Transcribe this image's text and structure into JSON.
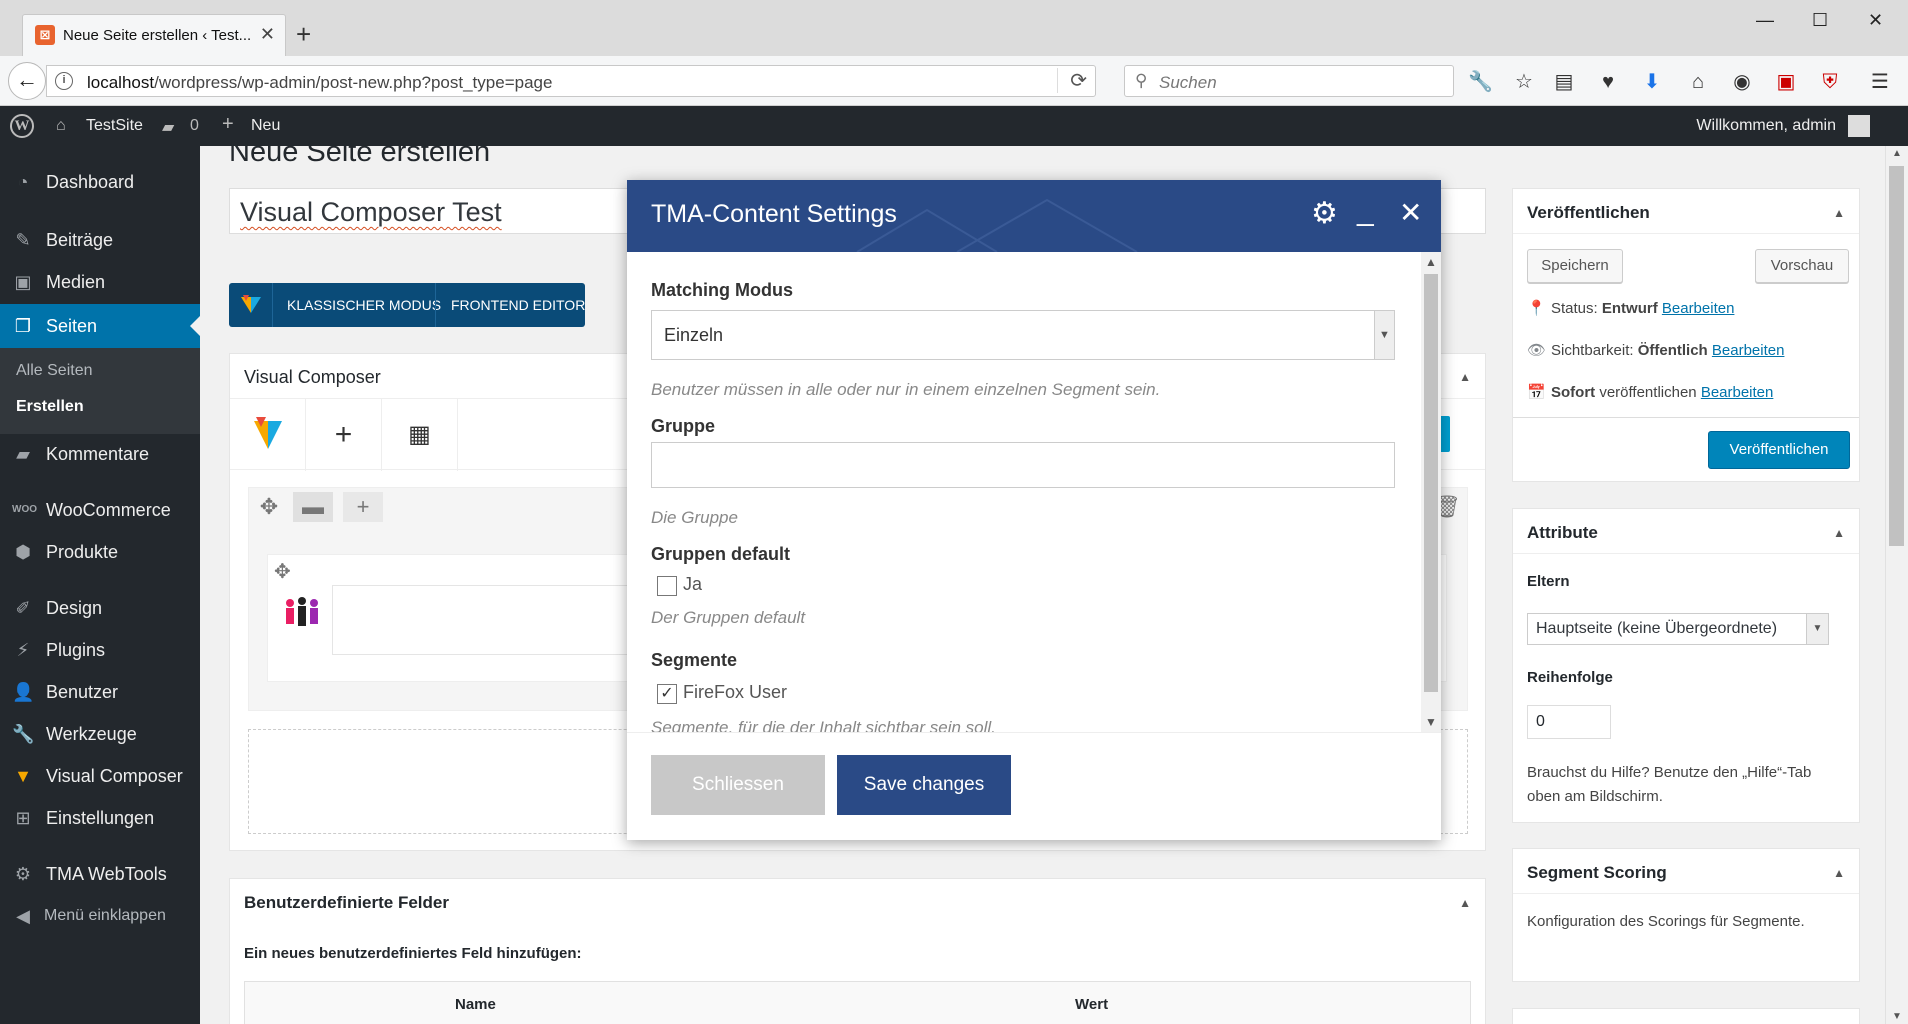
{
  "browser": {
    "tab_title": "Neue Seite erstellen ‹ Test...",
    "url_host": "localhost",
    "url_path": "/wordpress/wp-admin/post-new.php?post_type=page",
    "search_placeholder": "Suchen"
  },
  "adminbar": {
    "site_name": "TestSite",
    "comments_count": "0",
    "new_label": "Neu",
    "welcome": "Willkommen, admin"
  },
  "sidebar": {
    "dashboard": "Dashboard",
    "posts": "Beiträge",
    "media": "Medien",
    "pages": "Seiten",
    "pages_all": "Alle Seiten",
    "pages_new": "Erstellen",
    "comments": "Kommentare",
    "woocommerce": "WooCommerce",
    "products": "Produkte",
    "design": "Design",
    "plugins": "Plugins",
    "users": "Benutzer",
    "tools": "Werkzeuge",
    "visual_composer": "Visual Composer",
    "settings": "Einstellungen",
    "tma_webtools": "TMA WebTools",
    "collapse": "Menü einklappen"
  },
  "main": {
    "page_title": "Neue Seite erstellen",
    "post_title": "Visual Composer Test",
    "classic_mode": "KLASSISCHER MODUS",
    "frontend_editor": "FRONTEND EDITOR",
    "vc_panel_title": "Visual Composer",
    "custom_fields_title": "Benutzerdefinierte Felder",
    "custom_fields_add": "Ein neues benutzerdefiniertes Feld hinzufügen:",
    "col_name": "Name",
    "col_value": "Wert"
  },
  "publish": {
    "title": "Veröffentlichen",
    "save": "Speichern",
    "preview": "Vorschau",
    "status_label": "Status:",
    "status_value": "Entwurf",
    "visibility_label": "Sichtbarkeit:",
    "visibility_value": "Öffentlich",
    "publish_when_bold": "Sofort",
    "publish_when_rest": "veröffentlichen",
    "edit": "Bearbeiten",
    "publish_button": "Veröffentlichen"
  },
  "attributes": {
    "title": "Attribute",
    "parent_label": "Eltern",
    "parent_value": "Hauptseite (keine Übergeordnete)",
    "order_label": "Reihenfolge",
    "order_value": "0",
    "help": "Brauchst du Hilfe? Benutze den „Hilfe“-Tab oben am Bildschirm."
  },
  "segment_scoring": {
    "title": "Segment Scoring",
    "text": "Konfiguration des Scorings für Segmente."
  },
  "modal": {
    "title": "TMA-Content Settings",
    "matching_label": "Matching Modus",
    "matching_value": "Einzeln",
    "matching_help": "Benutzer müssen in alle oder nur in einem einzelnen Segment sein.",
    "group_label": "Gruppe",
    "group_value": "",
    "group_help": "Die Gruppe",
    "group_default_label": "Gruppen default",
    "group_default_option": "Ja",
    "group_default_checked": false,
    "group_default_help": "Der Gruppen default",
    "segments_label": "Segmente",
    "segment_option": "FireFox User",
    "segment_checked": true,
    "segments_help": "Segmente, für die der Inhalt sichtbar sein soll.",
    "close_button": "Schliessen",
    "save_button": "Save changes"
  }
}
